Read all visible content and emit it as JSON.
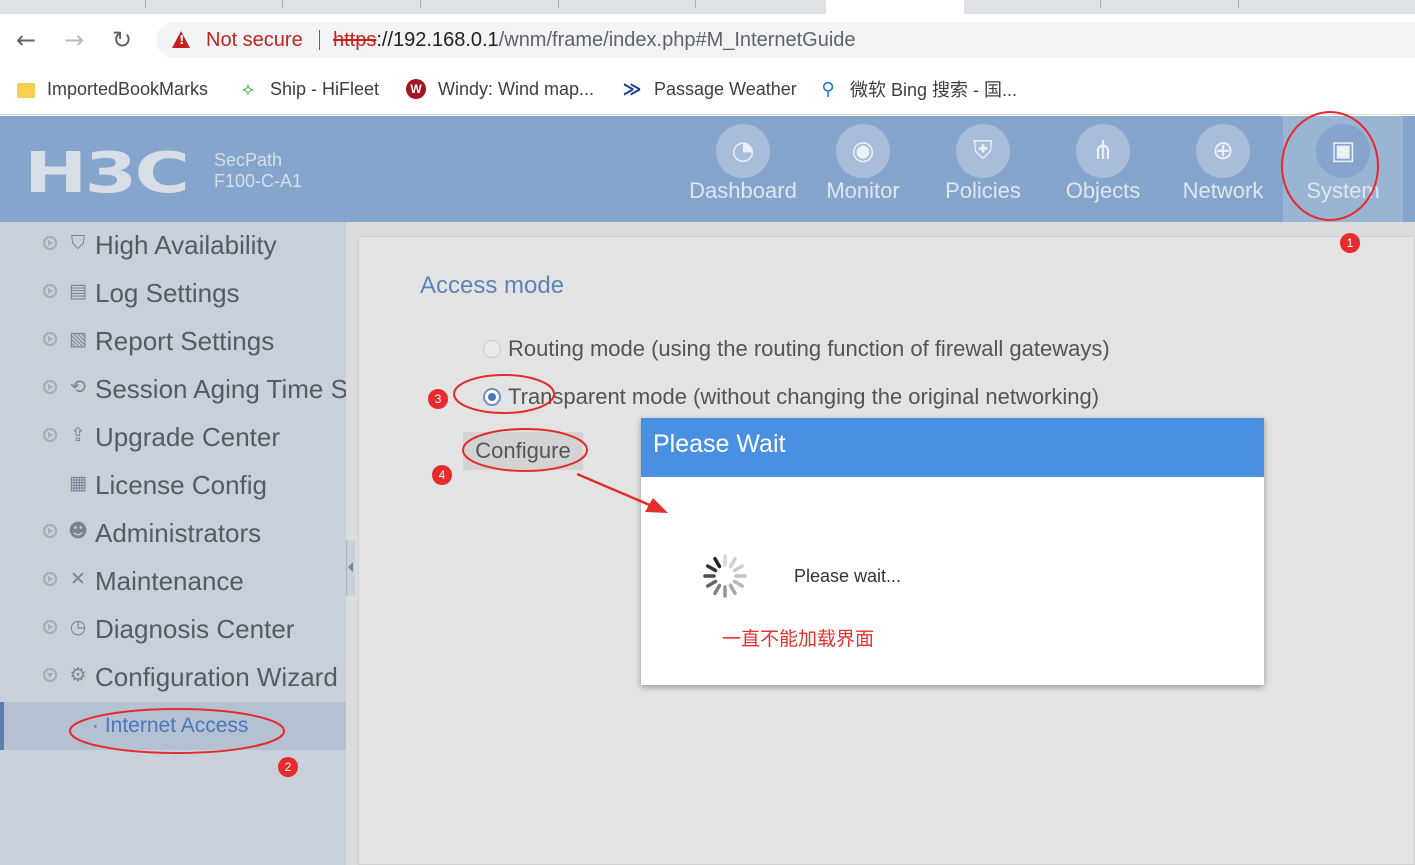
{
  "browser": {
    "back_icon": "←",
    "forward_icon": "→",
    "reload_icon": "↻",
    "security_label": "Not secure",
    "url_scheme": "https",
    "url_host": "://192.168.0.1",
    "url_path": "/wnm/frame/index.php#M_InternetGuide",
    "bookmarks": [
      {
        "label": "ImportedBookMarks",
        "icon": "folder-icon"
      },
      {
        "label": "Ship - HiFleet",
        "icon": "ship-icon"
      },
      {
        "label": "Windy: Wind map...",
        "icon": "windy-icon"
      },
      {
        "label": "Passage Weather",
        "icon": "passage-weather-icon"
      },
      {
        "label": "微软 Bing 搜索 - 国...",
        "icon": "bing-search-icon"
      }
    ]
  },
  "app": {
    "logo": "H3C",
    "product_line1": "SecPath",
    "product_line2": "F100-C-A1",
    "nav": [
      {
        "label": "Dashboard",
        "icon": "dashboard-gauge-icon"
      },
      {
        "label": "Monitor",
        "icon": "monitor-camera-icon"
      },
      {
        "label": "Policies",
        "icon": "policies-shield-icon"
      },
      {
        "label": "Objects",
        "icon": "objects-share-icon"
      },
      {
        "label": "Network",
        "icon": "network-globe-icon"
      },
      {
        "label": "System",
        "icon": "system-screen-icon",
        "active": true
      }
    ]
  },
  "sidebar": {
    "items": [
      {
        "label": "High Availability",
        "icon": "shield-icon"
      },
      {
        "label": "Log Settings",
        "icon": "log-icon"
      },
      {
        "label": "Report Settings",
        "icon": "report-icon"
      },
      {
        "label": "Session Aging Time Se",
        "icon": "session-icon"
      },
      {
        "label": "Upgrade Center",
        "icon": "upload-icon"
      },
      {
        "label": "License Config",
        "icon": "license-icon"
      },
      {
        "label": "Administrators",
        "icon": "admin-users-icon"
      },
      {
        "label": "Maintenance",
        "icon": "tools-icon"
      },
      {
        "label": "Diagnosis Center",
        "icon": "diagnosis-icon"
      },
      {
        "label": "Configuration Wizard",
        "icon": "gear-icon"
      }
    ],
    "sub_item": "· Internet Access"
  },
  "main": {
    "section_title": "Access mode",
    "options": [
      {
        "label": "Routing mode (using the routing function of firewall gateways)",
        "checked": false
      },
      {
        "label": "Transparent mode (without changing the original networking)",
        "checked": true
      }
    ],
    "configure_label": "Configure"
  },
  "modal": {
    "title": "Please Wait",
    "message": "Please wait...",
    "note": "一直不能加载界面"
  },
  "annotations": {
    "badges": [
      "1",
      "2",
      "3",
      "4"
    ],
    "color": "#e52b2b"
  }
}
